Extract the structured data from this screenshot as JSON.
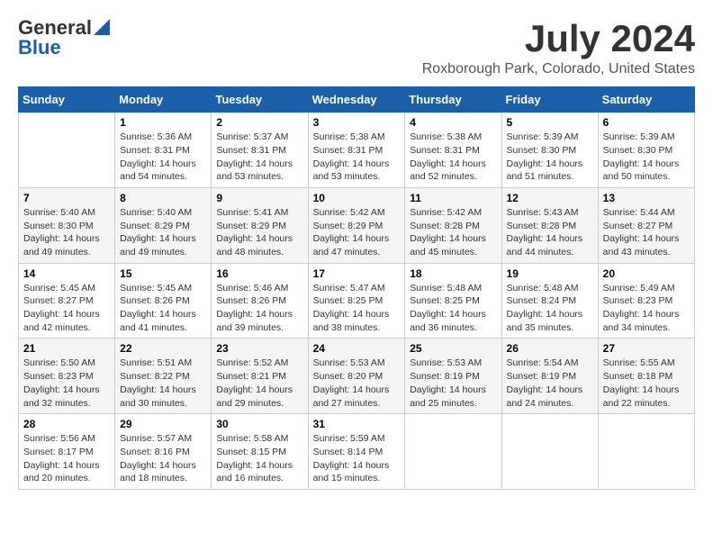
{
  "logo": {
    "general": "General",
    "blue": "Blue"
  },
  "title": "July 2024",
  "location": "Roxborough Park, Colorado, United States",
  "days_of_week": [
    "Sunday",
    "Monday",
    "Tuesday",
    "Wednesday",
    "Thursday",
    "Friday",
    "Saturday"
  ],
  "weeks": [
    [
      {
        "day": "",
        "content": ""
      },
      {
        "day": "1",
        "content": "Sunrise: 5:36 AM\nSunset: 8:31 PM\nDaylight: 14 hours\nand 54 minutes."
      },
      {
        "day": "2",
        "content": "Sunrise: 5:37 AM\nSunset: 8:31 PM\nDaylight: 14 hours\nand 53 minutes."
      },
      {
        "day": "3",
        "content": "Sunrise: 5:38 AM\nSunset: 8:31 PM\nDaylight: 14 hours\nand 53 minutes."
      },
      {
        "day": "4",
        "content": "Sunrise: 5:38 AM\nSunset: 8:31 PM\nDaylight: 14 hours\nand 52 minutes."
      },
      {
        "day": "5",
        "content": "Sunrise: 5:39 AM\nSunset: 8:30 PM\nDaylight: 14 hours\nand 51 minutes."
      },
      {
        "day": "6",
        "content": "Sunrise: 5:39 AM\nSunset: 8:30 PM\nDaylight: 14 hours\nand 50 minutes."
      }
    ],
    [
      {
        "day": "7",
        "content": "Sunrise: 5:40 AM\nSunset: 8:30 PM\nDaylight: 14 hours\nand 49 minutes."
      },
      {
        "day": "8",
        "content": "Sunrise: 5:40 AM\nSunset: 8:29 PM\nDaylight: 14 hours\nand 49 minutes."
      },
      {
        "day": "9",
        "content": "Sunrise: 5:41 AM\nSunset: 8:29 PM\nDaylight: 14 hours\nand 48 minutes."
      },
      {
        "day": "10",
        "content": "Sunrise: 5:42 AM\nSunset: 8:29 PM\nDaylight: 14 hours\nand 47 minutes."
      },
      {
        "day": "11",
        "content": "Sunrise: 5:42 AM\nSunset: 8:28 PM\nDaylight: 14 hours\nand 45 minutes."
      },
      {
        "day": "12",
        "content": "Sunrise: 5:43 AM\nSunset: 8:28 PM\nDaylight: 14 hours\nand 44 minutes."
      },
      {
        "day": "13",
        "content": "Sunrise: 5:44 AM\nSunset: 8:27 PM\nDaylight: 14 hours\nand 43 minutes."
      }
    ],
    [
      {
        "day": "14",
        "content": "Sunrise: 5:45 AM\nSunset: 8:27 PM\nDaylight: 14 hours\nand 42 minutes."
      },
      {
        "day": "15",
        "content": "Sunrise: 5:45 AM\nSunset: 8:26 PM\nDaylight: 14 hours\nand 41 minutes."
      },
      {
        "day": "16",
        "content": "Sunrise: 5:46 AM\nSunset: 8:26 PM\nDaylight: 14 hours\nand 39 minutes."
      },
      {
        "day": "17",
        "content": "Sunrise: 5:47 AM\nSunset: 8:25 PM\nDaylight: 14 hours\nand 38 minutes."
      },
      {
        "day": "18",
        "content": "Sunrise: 5:48 AM\nSunset: 8:25 PM\nDaylight: 14 hours\nand 36 minutes."
      },
      {
        "day": "19",
        "content": "Sunrise: 5:48 AM\nSunset: 8:24 PM\nDaylight: 14 hours\nand 35 minutes."
      },
      {
        "day": "20",
        "content": "Sunrise: 5:49 AM\nSunset: 8:23 PM\nDaylight: 14 hours\nand 34 minutes."
      }
    ],
    [
      {
        "day": "21",
        "content": "Sunrise: 5:50 AM\nSunset: 8:23 PM\nDaylight: 14 hours\nand 32 minutes."
      },
      {
        "day": "22",
        "content": "Sunrise: 5:51 AM\nSunset: 8:22 PM\nDaylight: 14 hours\nand 30 minutes."
      },
      {
        "day": "23",
        "content": "Sunrise: 5:52 AM\nSunset: 8:21 PM\nDaylight: 14 hours\nand 29 minutes."
      },
      {
        "day": "24",
        "content": "Sunrise: 5:53 AM\nSunset: 8:20 PM\nDaylight: 14 hours\nand 27 minutes."
      },
      {
        "day": "25",
        "content": "Sunrise: 5:53 AM\nSunset: 8:19 PM\nDaylight: 14 hours\nand 25 minutes."
      },
      {
        "day": "26",
        "content": "Sunrise: 5:54 AM\nSunset: 8:19 PM\nDaylight: 14 hours\nand 24 minutes."
      },
      {
        "day": "27",
        "content": "Sunrise: 5:55 AM\nSunset: 8:18 PM\nDaylight: 14 hours\nand 22 minutes."
      }
    ],
    [
      {
        "day": "28",
        "content": "Sunrise: 5:56 AM\nSunset: 8:17 PM\nDaylight: 14 hours\nand 20 minutes."
      },
      {
        "day": "29",
        "content": "Sunrise: 5:57 AM\nSunset: 8:16 PM\nDaylight: 14 hours\nand 18 minutes."
      },
      {
        "day": "30",
        "content": "Sunrise: 5:58 AM\nSunset: 8:15 PM\nDaylight: 14 hours\nand 16 minutes."
      },
      {
        "day": "31",
        "content": "Sunrise: 5:59 AM\nSunset: 8:14 PM\nDaylight: 14 hours\nand 15 minutes."
      },
      {
        "day": "",
        "content": ""
      },
      {
        "day": "",
        "content": ""
      },
      {
        "day": "",
        "content": ""
      }
    ]
  ]
}
